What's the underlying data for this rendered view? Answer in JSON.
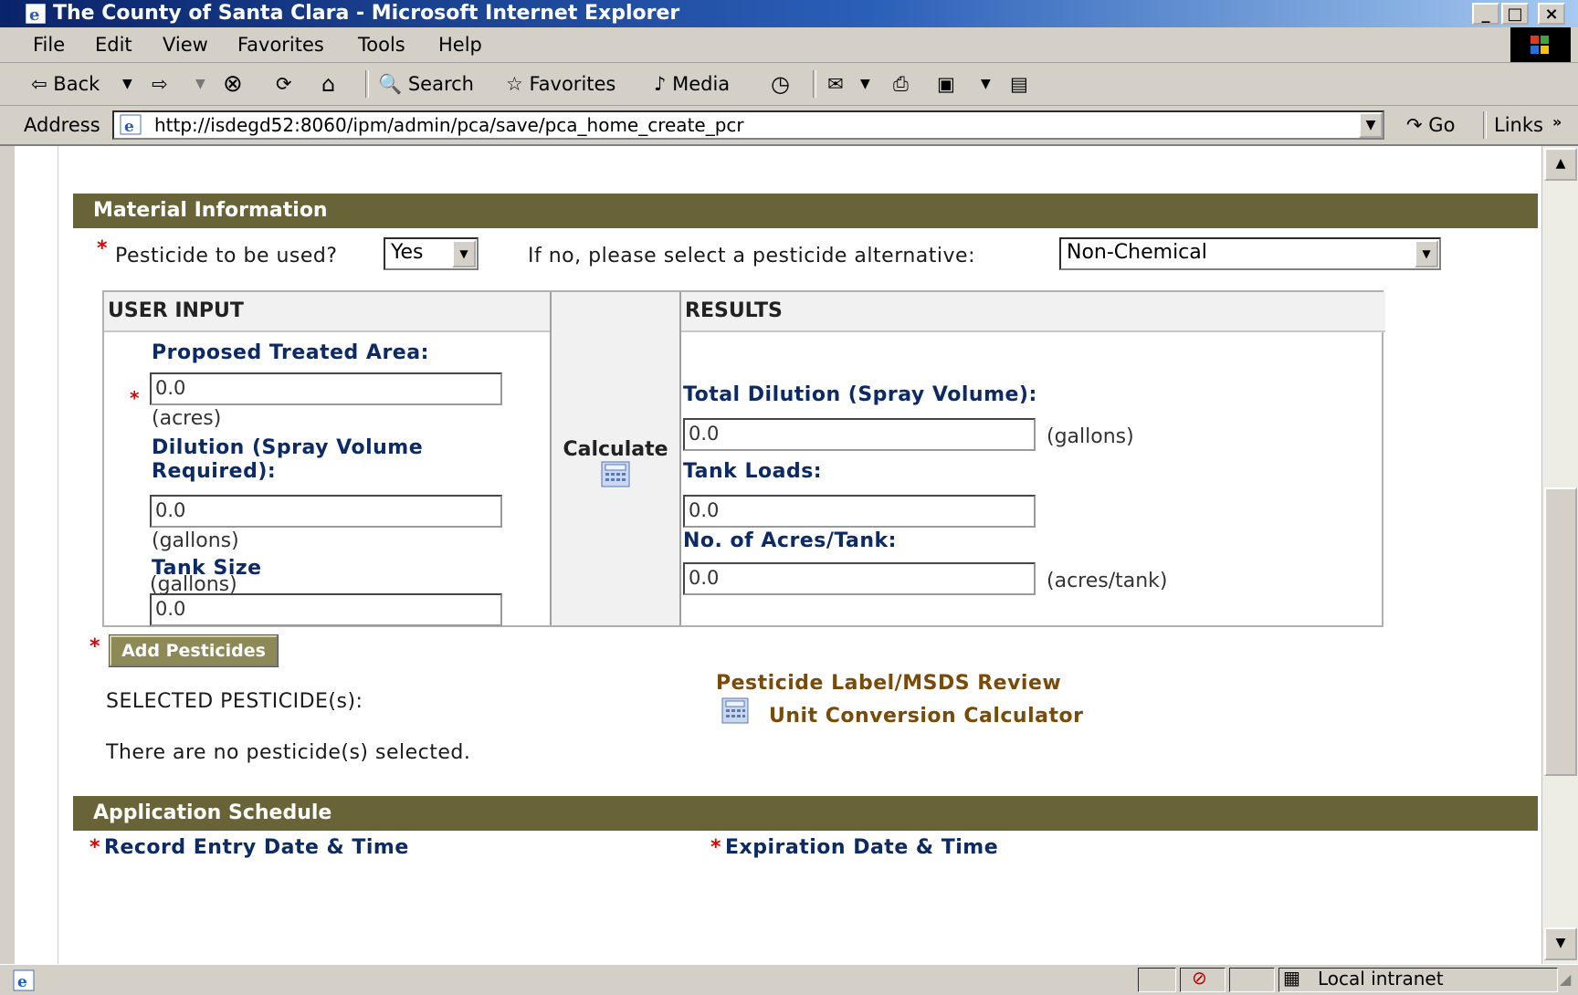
{
  "window": {
    "title": "The County of Santa Clara - Microsoft Internet Explorer",
    "minimize_glyph": "_",
    "maximize_glyph": "□",
    "close_glyph": "×"
  },
  "menu": [
    "File",
    "Edit",
    "View",
    "Favorites",
    "Tools",
    "Help"
  ],
  "toolbar": {
    "back_label": "Back",
    "search_label": "Search",
    "favorites_label": "Favorites",
    "media_label": "Media"
  },
  "address": {
    "label": "Address",
    "url": "http://isdegd52:8060/ipm/admin/pca/save/pca_home_create_pcr",
    "go_label": "Go",
    "links_label": "Links"
  },
  "material": {
    "header": "Material Information",
    "pesticide_question": "Pesticide to be used?",
    "pesticide_value": "Yes",
    "alternative_label": "If no, please select a pesticide alternative:",
    "alternative_value": "Non-Chemical",
    "user_input_header": "USER INPUT",
    "results_header": "RESULTS",
    "calculate_label": "Calculate",
    "treated_area_label": "Proposed Treated Area:",
    "treated_area_value": "0.0",
    "treated_area_unit": "(acres)",
    "dilution_label_1": "Dilution (Spray Volume",
    "dilution_label_2": "Required):",
    "dilution_value": "0.0",
    "dilution_unit": "(gallons)",
    "tank_size_label": "Tank Size",
    "tank_size_value": "0.0",
    "tank_size_unit": "(gallons)",
    "total_dilution_label": "Total Dilution (Spray Volume):",
    "total_dilution_value": "0.0",
    "total_dilution_unit": "(gallons)",
    "tank_loads_label": "Tank Loads:",
    "tank_loads_value": "0.0",
    "acres_per_tank_label": "No. of Acres/Tank:",
    "acres_per_tank_value": "0.0",
    "acres_per_tank_unit": "(acres/tank)",
    "add_pesticides_label": "Add Pesticides",
    "selected_label": "SELECTED PESTICIDE(s):",
    "none_selected_text": "There are no pesticide(s) selected.",
    "label_review_link": "Pesticide Label/MSDS Review",
    "unit_conversion_link": "Unit Conversion Calculator"
  },
  "schedule": {
    "header": "Application Schedule",
    "record_entry_label": "Record Entry Date & Time",
    "expiration_label": "Expiration Date & Time"
  },
  "status": {
    "zone_label": "Local intranet"
  },
  "colors": {
    "section_bar": "#686438",
    "field_label": "#0b2a66",
    "link": "#7a4a08",
    "required": "#e00000"
  }
}
